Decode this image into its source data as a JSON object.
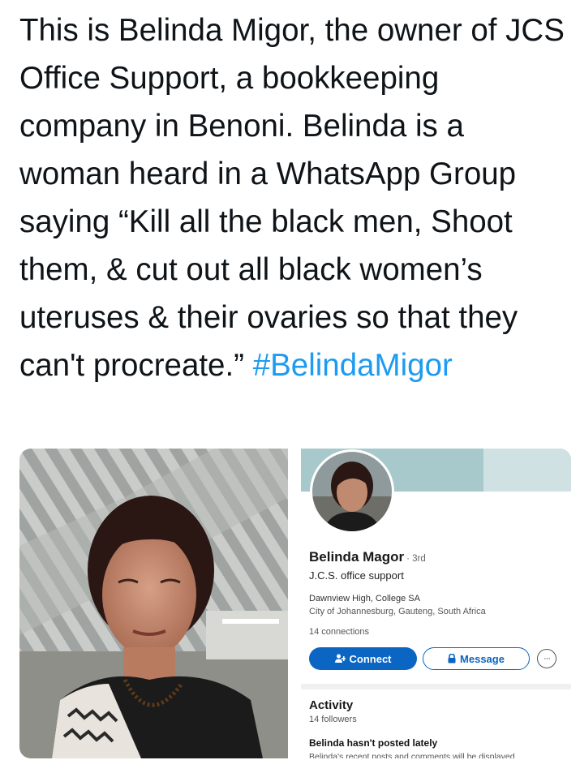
{
  "tweet": {
    "text_part1": "This is Belinda Migor, the owner of JCS Office Support, a bookkeeping company in Benoni. Belinda is a woman heard in a WhatsApp Group saying “Kill all the black men, Shoot them, & cut out all black women’s uteruses & their ovaries so that they can't procreate.”",
    "hashtag": "#BelindaMigor",
    "hashtag_color": "#1d9bf0"
  },
  "profile_card": {
    "name": "Belinda Magor",
    "degree": "· 3rd",
    "headline": "J.C.S. office support",
    "education": "Dawnview High, College SA",
    "location": "City of Johannesburg, Gauteng, South Africa",
    "connections": "14 connections",
    "connect_label": "Connect",
    "message_label": "Message",
    "more_label": "···",
    "accent_color": "#0a66c2",
    "icons": [
      "add-person-icon",
      "lock-icon",
      "more-icon"
    ]
  },
  "activity": {
    "title": "Activity",
    "followers": "14 followers",
    "no_posts": "Belinda hasn't posted lately",
    "sub": "Belinda's recent posts and comments will be displayed"
  }
}
